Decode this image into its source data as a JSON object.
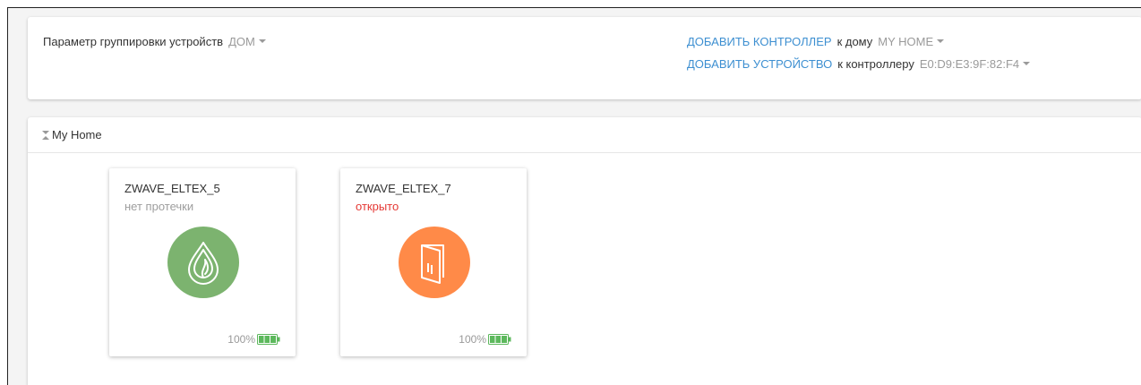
{
  "grouping": {
    "label": "Параметр группировки устройств",
    "value": "ДОМ"
  },
  "add_controller": {
    "link": "ДОБАВИТЬ КОНТРОЛЛЕР",
    "text": "к дому",
    "value": "MY HOME"
  },
  "add_device": {
    "link": "ДОБАВИТЬ УСТРОЙСТВО",
    "text": "к контроллеру",
    "value": "E0:D9:E3:9F:82:F4"
  },
  "home": {
    "title": "My Home"
  },
  "devices": [
    {
      "name": "ZWAVE_ELTEX_5",
      "status": "нет протечки",
      "status_color": "#9e9e9e",
      "icon": "water-drop-icon",
      "icon_color": "#7cb36f",
      "battery": "100%"
    },
    {
      "name": "ZWAVE_ELTEX_7",
      "status": "открыто",
      "status_color": "#e53935",
      "icon": "door-open-icon",
      "icon_color": "#ff8a48",
      "battery": "100%"
    }
  ],
  "colors": {
    "link": "#3d8fd1",
    "battery": "#5cb85c"
  }
}
